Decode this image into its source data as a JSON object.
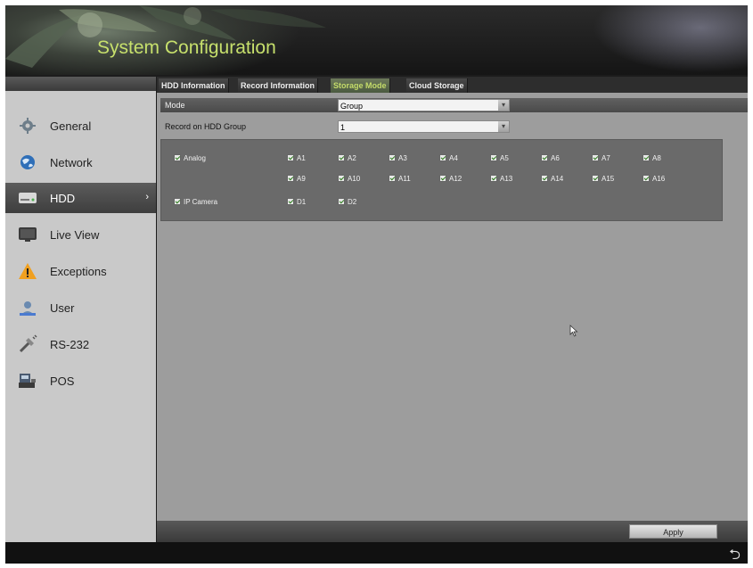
{
  "header": {
    "title": "System Configuration"
  },
  "sidebar": {
    "items": [
      {
        "label": "General",
        "icon": "gear-icon"
      },
      {
        "label": "Network",
        "icon": "globe-icon"
      },
      {
        "label": "HDD",
        "icon": "hdd-icon",
        "active": true
      },
      {
        "label": "Live View",
        "icon": "monitor-icon"
      },
      {
        "label": "Exceptions",
        "icon": "warning-icon"
      },
      {
        "label": "User",
        "icon": "user-icon"
      },
      {
        "label": "RS-232",
        "icon": "serial-port-icon"
      },
      {
        "label": "POS",
        "icon": "pos-terminal-icon"
      }
    ],
    "active_chevron": "›"
  },
  "tabs": [
    {
      "label": "HDD Information"
    },
    {
      "label": "Record Information"
    },
    {
      "label": "Storage Mode",
      "active": true
    },
    {
      "label": "Cloud Storage"
    }
  ],
  "form": {
    "mode_label": "Mode",
    "mode_value": "Group",
    "group_label": "Record on HDD Group",
    "group_value": "1",
    "dropdown_glyph": "▾"
  },
  "channels": {
    "analog_label": "Analog",
    "analog": [
      "A1",
      "A2",
      "A3",
      "A4",
      "A5",
      "A6",
      "A7",
      "A8",
      "A9",
      "A10",
      "A11",
      "A12",
      "A13",
      "A14",
      "A15",
      "A16"
    ],
    "ip_label": "IP Camera",
    "ip": [
      "D1",
      "D2"
    ]
  },
  "actions": {
    "apply_label": "Apply",
    "back_glyph": "⮌"
  },
  "colors": {
    "accent": "#c7e06c",
    "panel": "#9d9d9d",
    "sidebar": "#c9c9c9"
  }
}
